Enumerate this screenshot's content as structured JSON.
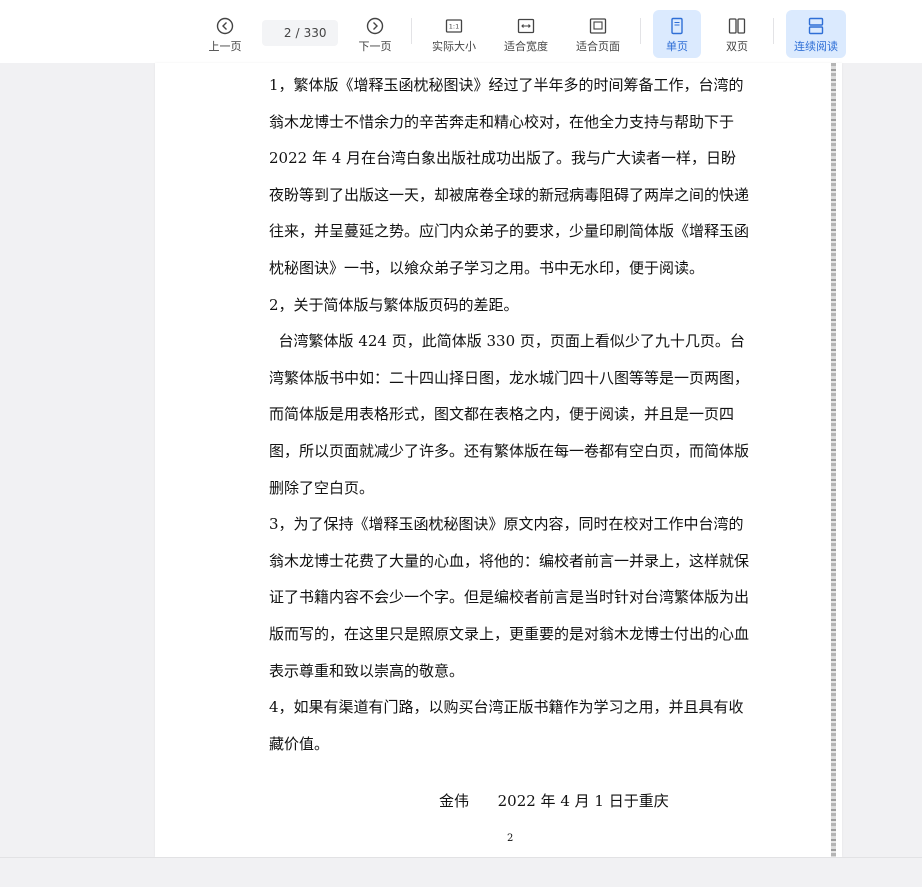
{
  "toolbar": {
    "prev_label": "上一页",
    "current_page": "2",
    "page_separator": "/",
    "total_pages": "330",
    "next_label": "下一页",
    "actual_size_icon_text": "1:1",
    "actual_size_label": "实际大小",
    "fit_width_label": "适合宽度",
    "fit_page_label": "适合页面",
    "single_page_label": "单页",
    "double_page_label": "双页",
    "continuous_label": "连续阅读",
    "active_color": "#2f6fd6",
    "active_bg": "#dbeafe"
  },
  "document": {
    "paragraphs": [
      "1，繁体版《增释玉函枕秘图诀》经过了半年多的时间筹备工作，台湾的翁木龙博士不惜余力的辛苦奔走和精心校对，在他全力支持与帮助下于 2022 年 4 月在台湾白象出版社成功出版了。我与广大读者一样，日盼夜盼等到了出版这一天，却被席卷全球的新冠病毒阻碍了两岸之间的快递往来，并呈蔓延之势。应门内众弟子的要求，少量印刷简体版《增释玉函枕秘图诀》一书，以飨众弟子学习之用。书中无水印，便于阅读。",
      "2，关于简体版与繁体版页码的差距。",
      "  台湾繁体版 424 页，此简体版 330 页，页面上看似少了九十几页。台湾繁体版书中如：二十四山择日图，龙水城门四十八图等等是一页两图，而简体版是用表格形式，图文都在表格之内，便于阅读，并且是一页四图，所以页面就减少了许多。还有繁体版在每一卷都有空白页，而简体版删除了空白页。",
      "3，为了保持《增释玉函枕秘图诀》原文内容，同时在校对工作中台湾的翁木龙博士花费了大量的心血，将他的：编校者前言一并录上，这样就保证了书籍内容不会少一个字。但是编校者前言是当时针对台湾繁体版为出版而写的，在这里只是照原文录上，更重要的是对翁木龙博士付出的心血表示尊重和致以崇高的敬意。",
      "4，如果有渠道有门路，以购买台湾正版书籍作为学习之用，并且具有收藏价值。"
    ],
    "signature": "金伟      2022 年 4 月 1 日于重庆",
    "page_number": "2"
  }
}
